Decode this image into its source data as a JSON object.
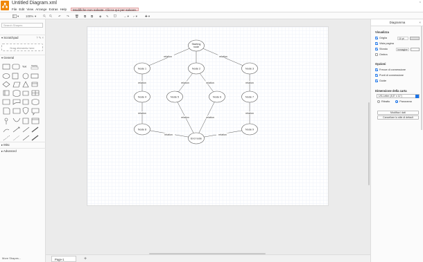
{
  "header": {
    "title": "Untitled Diagram.xml",
    "menu": [
      "File",
      "Edit",
      "View",
      "Arrange",
      "Extras",
      "Help"
    ],
    "unsaved_notice": "Modifiche non salvate. Clicca qui per salvare.",
    "collapse_glyph": "⌃"
  },
  "toolbar": {
    "zoom": "100%",
    "icons": [
      "view-panels-icon",
      "zoom-in-icon",
      "zoom-out-icon",
      "undo-icon",
      "redo-icon",
      "delete-icon",
      "to-front-icon",
      "to-back-icon",
      "fill-color-icon",
      "line-color-icon",
      "shadow-icon",
      "connection-style-icon",
      "waypoints-icon",
      "insert-icon"
    ]
  },
  "left_panel": {
    "search_placeholder": "Search Shapes",
    "scratchpad": "Scratchpad",
    "scratchpad_actions": "? ✎ ×",
    "drag_hint": "Drag elements here",
    "general": "General",
    "misc": "Misc",
    "advanced": "Advanced",
    "more_shapes": "More Shapes...",
    "shape_text_label": "Text",
    "shape_heading_label": "Heading"
  },
  "diagram": {
    "nodes": [
      {
        "id": "start",
        "label": "Starting node"
      },
      {
        "id": "n1",
        "label": "Node 1"
      },
      {
        "id": "n2",
        "label": "Node 2"
      },
      {
        "id": "n3",
        "label": "Node 3"
      },
      {
        "id": "n4",
        "label": "Node 4"
      },
      {
        "id": "n5",
        "label": "Node 5"
      },
      {
        "id": "n6",
        "label": "Node 6"
      },
      {
        "id": "n7",
        "label": "Node 7"
      },
      {
        "id": "n8",
        "label": "Node 8"
      },
      {
        "id": "n9",
        "label": "Node 9"
      },
      {
        "id": "end",
        "label": "End node"
      }
    ],
    "edge_label": "relation"
  },
  "bottom": {
    "page_tab": "Page-1",
    "add_page": "+"
  },
  "right_panel": {
    "title": "Diagramma",
    "close": "×",
    "view_section": "Visualizza",
    "grid": "Griglia",
    "grid_size": "10 pt",
    "page_view": "Vista pagina",
    "background": "Sfondo",
    "image_button": "Immagine",
    "shadow": "Ombra",
    "options_section": "Opzioni",
    "connection_arrows": "Frecce di connessione",
    "connection_points": "Punti di connessione",
    "guides": "Guide",
    "paper_section": "Dimensione della carta",
    "paper_size": "US-Letter (8,5\" x 11\")",
    "portrait": "Ritratto",
    "landscape": "Panorama",
    "edit_data_button": "Modifica i dati",
    "clear_default_button": "Cancellare lo stile di default"
  },
  "colors": {
    "brand": "#f08705",
    "accent": "#1a73e8"
  }
}
